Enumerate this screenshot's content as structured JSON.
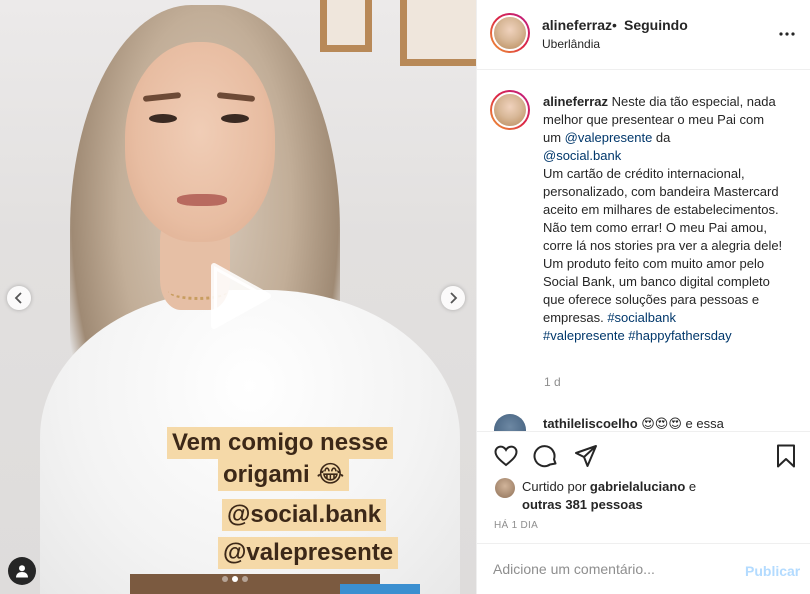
{
  "media": {
    "captions": [
      "Vem comigo nesse",
      "origami 😂",
      "@social.bank",
      "@valepresente"
    ],
    "carousel_dots": 3,
    "carousel_active": 1
  },
  "header": {
    "username": "alineferraz",
    "separator": "•",
    "follow_label": "Seguindo",
    "location": "Uberlândia"
  },
  "caption": {
    "username": "alineferraz",
    "text_1": " Neste dia tão especial, nada melhor que presentear o meu Pai com um ",
    "mention_1": "@valepresente",
    "text_2": " da ",
    "mention_2": "@social.bank",
    "text_3": "Um cartão de crédito internacional, personalizado, com bandeira Mastercard aceito em milhares de estabelecimentos. Não tem como errar! O meu Pai amou, corre lá nos stories pra ver a alegria dele!",
    "text_4": "Um produto feito com muito amor pelo Social Bank, um banco digital completo que oferece soluções para pessoas e empresas. ",
    "hashtag_1": "#socialbank",
    "hashtag_2": "#valepresente",
    "hashtag_3": "#happyfathersday",
    "time_ago": "1 d"
  },
  "comment_2": {
    "username": "tathileliscoelho",
    "text": " 😍😍😍 e essa",
    "more": "..."
  },
  "likes": {
    "prefix": "Curtido por ",
    "user": "gabrielaluciano",
    "connector": " e",
    "others": "outras 381 pessoas"
  },
  "post_date": "HÁ 1 DIA",
  "add_comment": {
    "placeholder": "Adicione um comentário...",
    "publish_label": "Publicar"
  },
  "colors": {
    "link": "#00376b",
    "publish_disabled": "#b3dbff",
    "caption_bg": "#f5d9a8"
  }
}
